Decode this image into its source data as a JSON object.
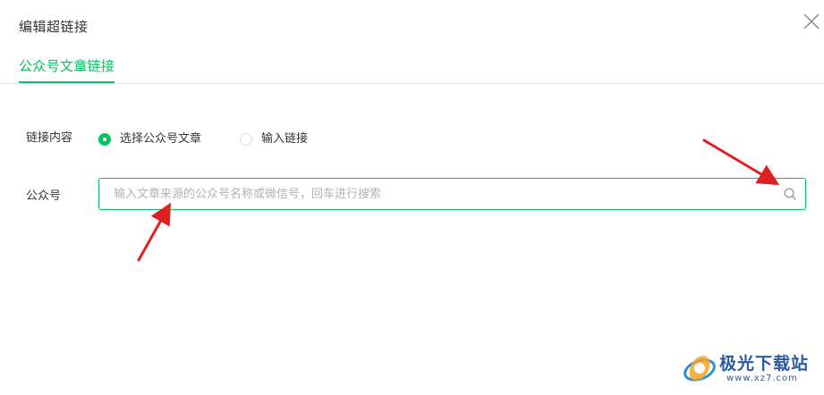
{
  "dialog": {
    "title": "编辑超链接",
    "close_icon": "close-icon"
  },
  "tabs": [
    {
      "label": "公众号文章链接",
      "active": true
    }
  ],
  "link_content": {
    "label": "链接内容",
    "options": [
      {
        "label": "选择公众号文章",
        "checked": true
      },
      {
        "label": "输入链接",
        "checked": false
      }
    ]
  },
  "account": {
    "label": "公众号",
    "value": "",
    "placeholder": "输入文章来源的公众号名称或微信号，回车进行搜索",
    "search_icon": "search-icon"
  },
  "watermark": {
    "text": "极光下载站",
    "url": "www.xz7.com"
  },
  "colors": {
    "accent": "#07c160",
    "arrow": "#e02020",
    "watermark": "#2c5a9e"
  }
}
